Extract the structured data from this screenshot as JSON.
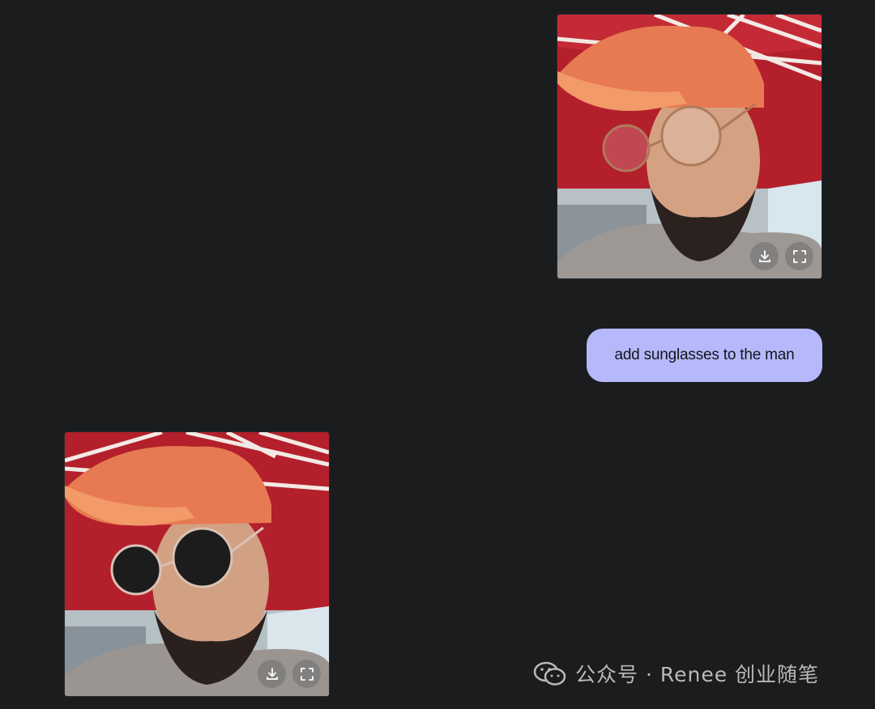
{
  "conversation": {
    "sent_image": {
      "description_icon": "photo-man-cap-clear-glasses",
      "actions": [
        {
          "name": "download-icon"
        },
        {
          "name": "fullscreen-icon"
        }
      ]
    },
    "prompt": {
      "text": "add sunglasses to the man"
    },
    "reply_image": {
      "description_icon": "photo-man-cap-sunglasses",
      "actions": [
        {
          "name": "download-icon"
        },
        {
          "name": "fullscreen-icon"
        }
      ]
    }
  },
  "watermark": {
    "text": "公众号 · Renee 创业随笔",
    "icon": "wechat-icon"
  },
  "colors": {
    "background": "#1b1c1e",
    "bubble": "#b5b9fb",
    "bubble_text": "#14161c",
    "umbrella_red": "#b3202c",
    "cap_orange": "#e77a52"
  }
}
